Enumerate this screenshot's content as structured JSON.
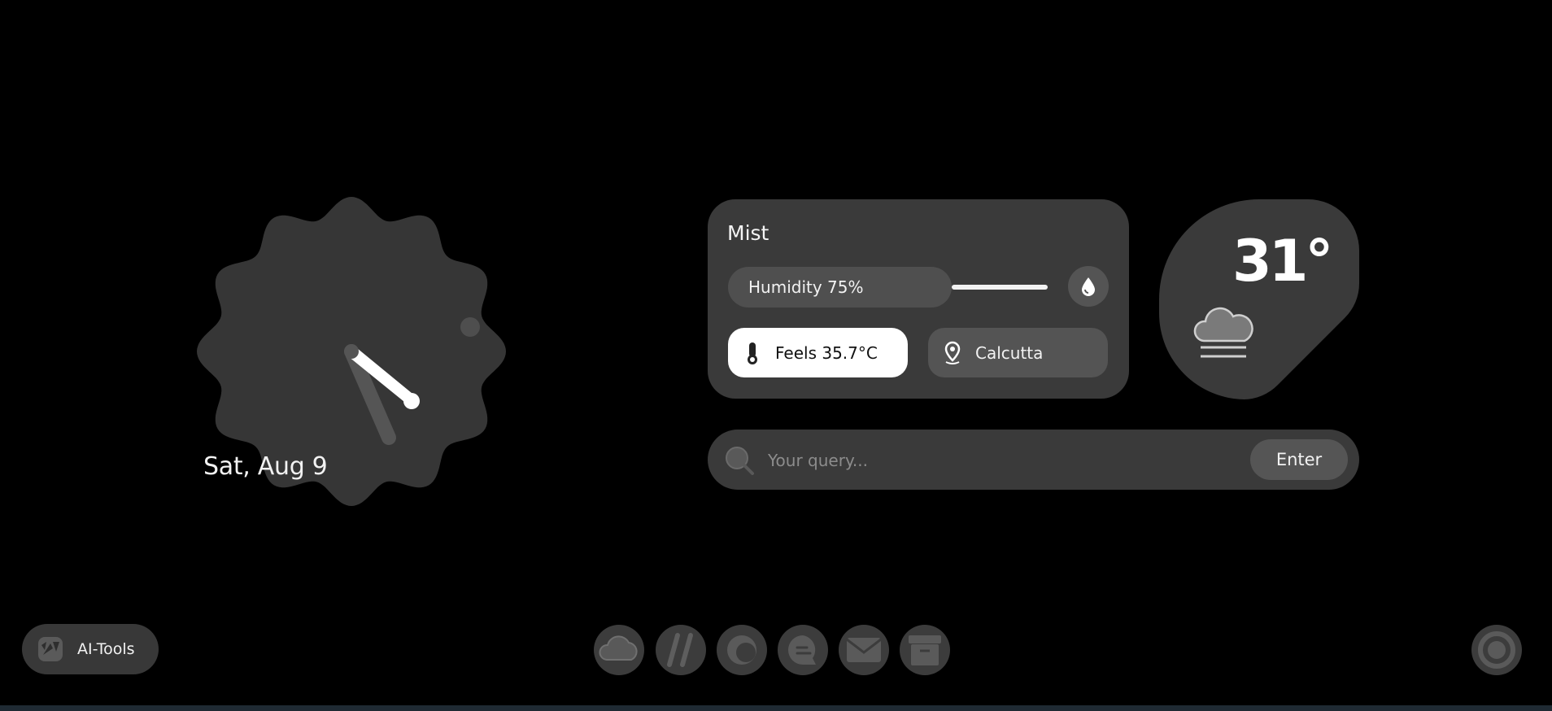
{
  "clock": {
    "date": "Sat, Aug 9"
  },
  "weather": {
    "condition": "Mist",
    "humidity_label": "Humidity 75%",
    "humidity_percent": 75,
    "feels_like": "Feels 35.7°C",
    "location": "Calcutta",
    "temperature": "31°",
    "icons": {
      "humidity": "water-drop-icon",
      "feels": "thermometer-icon",
      "location": "location-pin-icon",
      "condition": "mist-cloud-icon"
    }
  },
  "search": {
    "placeholder": "Your query...",
    "button_label": "Enter",
    "icon": "search-icon"
  },
  "ai_tools": {
    "label": "AI-Tools",
    "icon": "ai-tools-icon"
  },
  "dock": {
    "items": [
      {
        "icon": "cloud-icon"
      },
      {
        "icon": "double-slash-icon"
      },
      {
        "icon": "moon-circle-icon"
      },
      {
        "icon": "chat-bubble-icon"
      },
      {
        "icon": "mail-icon"
      },
      {
        "icon": "archive-box-icon"
      }
    ]
  },
  "profile": {
    "icon": "ring-profile-icon"
  },
  "colors": {
    "background": "#000000",
    "card": "#3a3a3a",
    "pill": "#545454",
    "text": "#f2f2f2"
  }
}
